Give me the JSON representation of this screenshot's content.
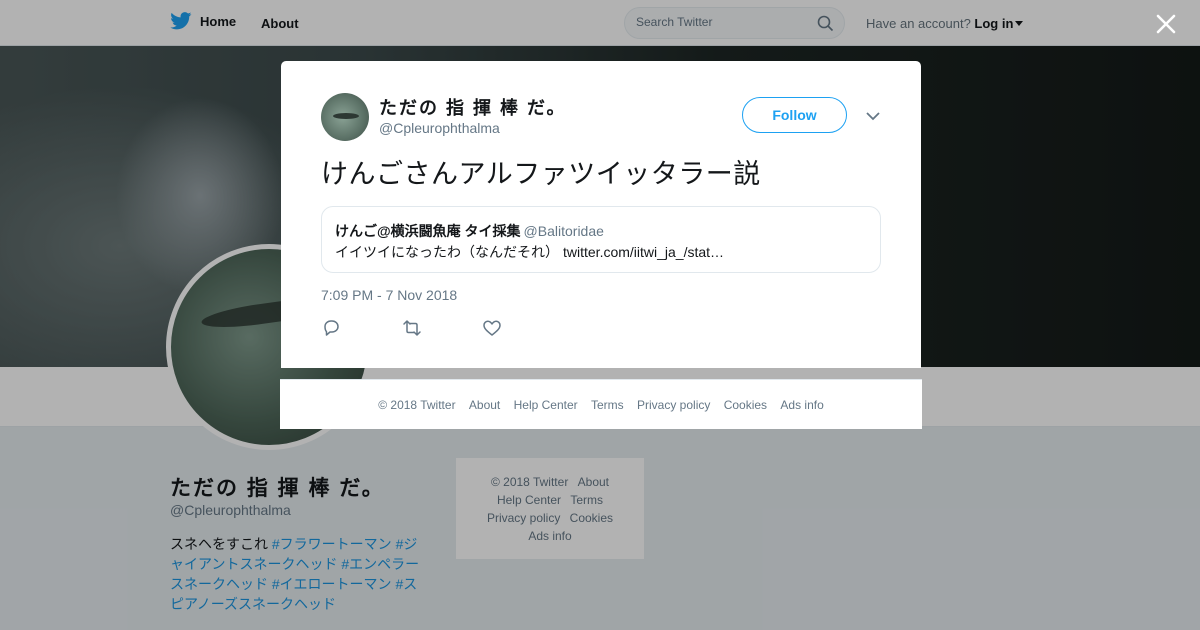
{
  "nav": {
    "home_label": "Home",
    "about_label": "About",
    "search_placeholder": "Search Twitter",
    "account_prompt": "Have an account?",
    "login_label": "Log in",
    "brand_color": "#1da1f2"
  },
  "profile": {
    "name": "ただの 指 揮 棒 だ。",
    "handle": "@Cpleurophthalma",
    "bio_text": "スネヘをすこれ",
    "bio_tags": [
      "#フラワートーマン",
      "#ジャイアントスネークヘッド",
      "#エンペラースネークヘッド",
      "#イエロートーマン",
      "#スピアノーズスネークヘッド"
    ]
  },
  "side_footer": {
    "items": [
      "© 2018 Twitter",
      "About",
      "Help Center",
      "Terms",
      "Privacy policy",
      "Cookies",
      "Ads info"
    ]
  },
  "tweet": {
    "author_name": "ただの 指 揮 棒 だ。",
    "author_handle": "@Cpleurophthalma",
    "follow_label": "Follow",
    "text": "けんごさんアルファツイッタラー説",
    "quoted": {
      "name": "けんご@横浜闘魚庵 タイ採集",
      "handle": "@Balitoridae",
      "text": "イイツイになったわ（なんだそれ）",
      "link": "twitter.com/iitwi_ja_/stat…"
    },
    "timestamp": "7:09 PM - 7 Nov 2018",
    "actions": [
      "reply-icon",
      "retweet-icon",
      "like-icon"
    ]
  },
  "modal_footer": {
    "items": [
      "© 2018 Twitter",
      "About",
      "Help Center",
      "Terms",
      "Privacy policy",
      "Cookies",
      "Ads info"
    ]
  }
}
